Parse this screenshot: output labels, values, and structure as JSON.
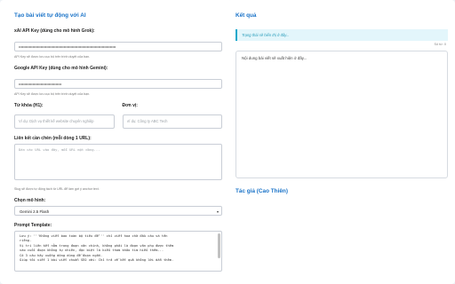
{
  "left": {
    "title": "Tạo bài viết tự động với AI",
    "xai": {
      "label": "xAI API Key (dùng cho mô hình Grok):",
      "value": "••••••••••••••••••••••••••••••••••••••••••••••••••••••••••••••••••••••••••••••••••••",
      "hint": "API Key sẽ được lưu cục bộ trên trình duyệt của bạn."
    },
    "google": {
      "label": "Google API Key (dùng cho mô hình Gemini):",
      "value": "•••••••••••••••••••••••••••••••••••••",
      "hint": "API Key sẽ được lưu cục bộ trên trình duyệt của bạn."
    },
    "keyword": {
      "label": "Từ khóa (H1):",
      "placeholder": "Ví dụ: Dịch vụ thiết kế website chuyên nghiệp"
    },
    "unit": {
      "label": "Đơn vị:",
      "placeholder": "Ví dụ: Công ty ABC Tech"
    },
    "links": {
      "label": "Liên kết cần chèn (mỗi dòng 1 URL):",
      "placeholder": "Dán các URL vào đây, mỗi URL một dòng...",
      "hint": "Slug sẽ được tự động tách từ URL để làm gợi ý anchor text."
    },
    "model": {
      "label": "Chọn mô hình:",
      "value": "Gemini 2.5 Flash"
    },
    "template": {
      "label": "Prompt Template:",
      "lines": [
        "Lưu ý: '''Không viết bao toàn bộ tiêu đề''' chỉ viết hoa chữ đầu câu và tên",
        "riêng.",
        "Vị trí liên kết nằm trong đoạn văn chính, không phải là đoạn văn phụ được thêm",
        "vào cuối đoạn không tự nhiên, đặc biệt là kiểu tham khảo tìm hiểu thêm...",
        "Có 3 câu hãy xuống dòng dùng để đoạn ngắn.",
        "Giúp tôi viết 1 bài viết chuẩn SEO với: Chỉ trả về kết quả không lời dẫn thêm."
      ]
    }
  },
  "right": {
    "title": "Kết quả",
    "status": "Trạng thái sẽ hiển thị ở đây...",
    "word_count": "Số từ: 0",
    "output_placeholder": "Nội dung bài viết sẽ xuất hiện ở đây...",
    "author": "Tác giả (Cao Thiên)"
  },
  "colors": {
    "accent": "#1a73c8",
    "status_bg": "#e3f6fb",
    "status_border": "#19a8cb",
    "page_bg": "#eef2f6"
  }
}
